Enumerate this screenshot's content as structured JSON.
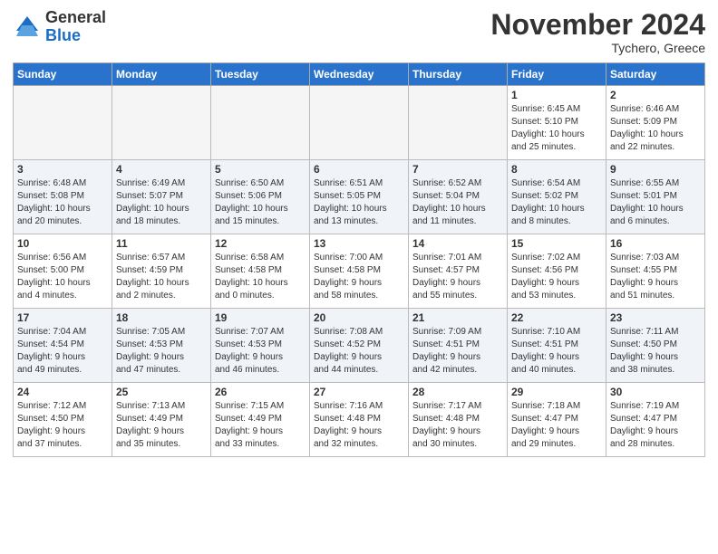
{
  "header": {
    "logo_general": "General",
    "logo_blue": "Blue",
    "month_title": "November 2024",
    "subtitle": "Tychero, Greece"
  },
  "weekdays": [
    "Sunday",
    "Monday",
    "Tuesday",
    "Wednesday",
    "Thursday",
    "Friday",
    "Saturday"
  ],
  "weeks": [
    [
      {
        "day": "",
        "detail": ""
      },
      {
        "day": "",
        "detail": ""
      },
      {
        "day": "",
        "detail": ""
      },
      {
        "day": "",
        "detail": ""
      },
      {
        "day": "",
        "detail": ""
      },
      {
        "day": "1",
        "detail": "Sunrise: 6:45 AM\nSunset: 5:10 PM\nDaylight: 10 hours\nand 25 minutes."
      },
      {
        "day": "2",
        "detail": "Sunrise: 6:46 AM\nSunset: 5:09 PM\nDaylight: 10 hours\nand 22 minutes."
      }
    ],
    [
      {
        "day": "3",
        "detail": "Sunrise: 6:48 AM\nSunset: 5:08 PM\nDaylight: 10 hours\nand 20 minutes."
      },
      {
        "day": "4",
        "detail": "Sunrise: 6:49 AM\nSunset: 5:07 PM\nDaylight: 10 hours\nand 18 minutes."
      },
      {
        "day": "5",
        "detail": "Sunrise: 6:50 AM\nSunset: 5:06 PM\nDaylight: 10 hours\nand 15 minutes."
      },
      {
        "day": "6",
        "detail": "Sunrise: 6:51 AM\nSunset: 5:05 PM\nDaylight: 10 hours\nand 13 minutes."
      },
      {
        "day": "7",
        "detail": "Sunrise: 6:52 AM\nSunset: 5:04 PM\nDaylight: 10 hours\nand 11 minutes."
      },
      {
        "day": "8",
        "detail": "Sunrise: 6:54 AM\nSunset: 5:02 PM\nDaylight: 10 hours\nand 8 minutes."
      },
      {
        "day": "9",
        "detail": "Sunrise: 6:55 AM\nSunset: 5:01 PM\nDaylight: 10 hours\nand 6 minutes."
      }
    ],
    [
      {
        "day": "10",
        "detail": "Sunrise: 6:56 AM\nSunset: 5:00 PM\nDaylight: 10 hours\nand 4 minutes."
      },
      {
        "day": "11",
        "detail": "Sunrise: 6:57 AM\nSunset: 4:59 PM\nDaylight: 10 hours\nand 2 minutes."
      },
      {
        "day": "12",
        "detail": "Sunrise: 6:58 AM\nSunset: 4:58 PM\nDaylight: 10 hours\nand 0 minutes."
      },
      {
        "day": "13",
        "detail": "Sunrise: 7:00 AM\nSunset: 4:58 PM\nDaylight: 9 hours\nand 58 minutes."
      },
      {
        "day": "14",
        "detail": "Sunrise: 7:01 AM\nSunset: 4:57 PM\nDaylight: 9 hours\nand 55 minutes."
      },
      {
        "day": "15",
        "detail": "Sunrise: 7:02 AM\nSunset: 4:56 PM\nDaylight: 9 hours\nand 53 minutes."
      },
      {
        "day": "16",
        "detail": "Sunrise: 7:03 AM\nSunset: 4:55 PM\nDaylight: 9 hours\nand 51 minutes."
      }
    ],
    [
      {
        "day": "17",
        "detail": "Sunrise: 7:04 AM\nSunset: 4:54 PM\nDaylight: 9 hours\nand 49 minutes."
      },
      {
        "day": "18",
        "detail": "Sunrise: 7:05 AM\nSunset: 4:53 PM\nDaylight: 9 hours\nand 47 minutes."
      },
      {
        "day": "19",
        "detail": "Sunrise: 7:07 AM\nSunset: 4:53 PM\nDaylight: 9 hours\nand 46 minutes."
      },
      {
        "day": "20",
        "detail": "Sunrise: 7:08 AM\nSunset: 4:52 PM\nDaylight: 9 hours\nand 44 minutes."
      },
      {
        "day": "21",
        "detail": "Sunrise: 7:09 AM\nSunset: 4:51 PM\nDaylight: 9 hours\nand 42 minutes."
      },
      {
        "day": "22",
        "detail": "Sunrise: 7:10 AM\nSunset: 4:51 PM\nDaylight: 9 hours\nand 40 minutes."
      },
      {
        "day": "23",
        "detail": "Sunrise: 7:11 AM\nSunset: 4:50 PM\nDaylight: 9 hours\nand 38 minutes."
      }
    ],
    [
      {
        "day": "24",
        "detail": "Sunrise: 7:12 AM\nSunset: 4:50 PM\nDaylight: 9 hours\nand 37 minutes."
      },
      {
        "day": "25",
        "detail": "Sunrise: 7:13 AM\nSunset: 4:49 PM\nDaylight: 9 hours\nand 35 minutes."
      },
      {
        "day": "26",
        "detail": "Sunrise: 7:15 AM\nSunset: 4:49 PM\nDaylight: 9 hours\nand 33 minutes."
      },
      {
        "day": "27",
        "detail": "Sunrise: 7:16 AM\nSunset: 4:48 PM\nDaylight: 9 hours\nand 32 minutes."
      },
      {
        "day": "28",
        "detail": "Sunrise: 7:17 AM\nSunset: 4:48 PM\nDaylight: 9 hours\nand 30 minutes."
      },
      {
        "day": "29",
        "detail": "Sunrise: 7:18 AM\nSunset: 4:47 PM\nDaylight: 9 hours\nand 29 minutes."
      },
      {
        "day": "30",
        "detail": "Sunrise: 7:19 AM\nSunset: 4:47 PM\nDaylight: 9 hours\nand 28 minutes."
      }
    ]
  ]
}
